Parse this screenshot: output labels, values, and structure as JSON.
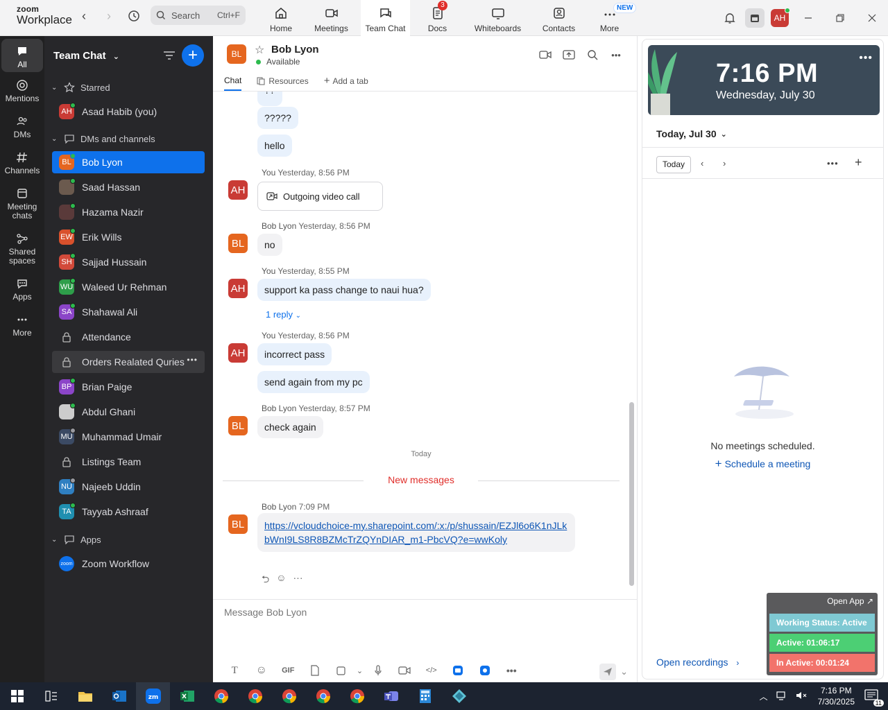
{
  "topbar": {
    "logo_top": "zoom",
    "logo_bottom": "Workplace",
    "search_placeholder": "Search",
    "search_shortcut": "Ctrl+F",
    "nav": [
      {
        "label": "Home",
        "icon": "home-icon"
      },
      {
        "label": "Meetings",
        "icon": "video-icon"
      },
      {
        "label": "Team Chat",
        "icon": "chat-icon",
        "active": true
      },
      {
        "label": "Docs",
        "icon": "docs-icon",
        "badge": "3"
      },
      {
        "label": "Whiteboards",
        "icon": "whiteboard-icon"
      },
      {
        "label": "Contacts",
        "icon": "contacts-icon"
      },
      {
        "label": "More",
        "icon": "more-icon",
        "badge_new": "NEW"
      }
    ],
    "user_initials": "AH"
  },
  "rail": [
    {
      "label": "All",
      "icon": "chat-bubble-icon",
      "active": true
    },
    {
      "label": "Mentions",
      "icon": "at-icon"
    },
    {
      "label": "DMs",
      "icon": "people-icon"
    },
    {
      "label": "Channels",
      "icon": "hash-icon"
    },
    {
      "label": "Meeting chats",
      "icon": "calendar-icon"
    },
    {
      "label": "Shared spaces",
      "icon": "share-icon"
    },
    {
      "label": "Apps",
      "icon": "apps-icon"
    },
    {
      "label": "More",
      "icon": "ellipsis-icon"
    }
  ],
  "sidebar": {
    "title": "Team Chat",
    "sections": {
      "starred": "Starred",
      "dms": "DMs and channels",
      "apps": "Apps"
    },
    "starred_items": [
      {
        "name": "Asad Habib (you)",
        "initials": "AH",
        "color": "#c93b35",
        "status": "online"
      }
    ],
    "items": [
      {
        "name": "Bob Lyon",
        "initials": "BL",
        "color": "#e5661f",
        "selected": true,
        "status": "online"
      },
      {
        "name": "Saad Hassan",
        "initials": "",
        "color": "#6b5a4e",
        "status": "online",
        "photo": true
      },
      {
        "name": "Hazama Nazir",
        "initials": "",
        "color": "#5a3a3a",
        "status": "online",
        "photo": true
      },
      {
        "name": "Erik Wills",
        "initials": "EW",
        "color": "#d9512c",
        "status": "online"
      },
      {
        "name": "Sajjad Hussain",
        "initials": "SH",
        "color": "#d24a3a",
        "status": "online"
      },
      {
        "name": "Waleed Ur Rehman",
        "initials": "WU",
        "color": "#2e9e4a",
        "status": "online"
      },
      {
        "name": "Shahawal Ali",
        "initials": "SA",
        "color": "#8b45c8",
        "status": "online"
      },
      {
        "name": "Attendance",
        "channel": true
      },
      {
        "name": "Orders Realated Quries",
        "channel": true,
        "hover": true
      },
      {
        "name": "Brian Paige",
        "initials": "BP",
        "color": "#8b45c8",
        "status": "online"
      },
      {
        "name": "Abdul Ghani",
        "initials": "",
        "color": "#cccccc",
        "status": "online",
        "photo": true
      },
      {
        "name": "Muhammad Umair",
        "initials": "MU",
        "color": "#3b4a64",
        "status": "away"
      },
      {
        "name": "Listings Team",
        "channel": true
      },
      {
        "name": "Najeeb Uddin",
        "initials": "NU",
        "color": "#2f7fc1",
        "status": "away"
      },
      {
        "name": "Tayyab Ashraaf",
        "initials": "TA",
        "color": "#1f8fb0",
        "status": "online"
      }
    ],
    "app_items": [
      {
        "name": "Zoom Workflow",
        "initials": "zoom",
        "color": "#0e71eb"
      }
    ]
  },
  "chat": {
    "contact_initials": "BL",
    "contact_name": "Bob Lyon",
    "contact_status": "Available",
    "tabs": [
      "Chat",
      "Resources",
      "Add a tab"
    ],
    "messages": [
      {
        "text_partial": "??"
      },
      {
        "text": "?????"
      },
      {
        "text": "hello"
      },
      {
        "sender": "You",
        "time": "Yesterday, 8:56 PM",
        "initials": "AH",
        "call": "Outgoing video call"
      },
      {
        "sender": "Bob Lyon",
        "time": "Yesterday, 8:56 PM",
        "initials": "BL",
        "text": "no"
      },
      {
        "sender": "You",
        "time": "Yesterday, 8:55 PM",
        "initials": "AH",
        "text": "support ka pass change to naui hua?",
        "reply": "1 reply"
      },
      {
        "sender": "You",
        "time": "Yesterday, 8:56 PM",
        "initials": "AH",
        "text": "incorrect pass",
        "text2": "send again from my pc"
      },
      {
        "sender": "Bob Lyon",
        "time": "Yesterday, 8:57 PM",
        "initials": "BL",
        "text": "check again"
      },
      {
        "sender": "Bob Lyon",
        "time": "7:09 PM",
        "initials": "BL",
        "link": "https://vcloudchoice-my.sharepoint.com/:x:/p/shussain/EZJl6o6K1nJLkbWnI9LS8R8BZMcTrZQYnDIAR_m1-PbcVQ?e=wwKoly"
      }
    ],
    "today_label": "Today",
    "new_messages_label": "New messages",
    "composer_placeholder": "Message Bob Lyon"
  },
  "right": {
    "time": "7:16 PM",
    "date": "Wednesday, July 30",
    "calendar_title": "Today, Jul 30",
    "today_button": "Today",
    "empty": "No meetings scheduled.",
    "schedule_link": "Schedule a meeting",
    "open_recordings": "Open recordings"
  },
  "widget": {
    "open_app": "Open App",
    "working_status": "Working Status: Active",
    "active": "Active: 01:06:17",
    "inactive": "In Active: 00:01:24",
    "colors": {
      "status": "#7fc9d3",
      "active": "#4ccf74",
      "inactive": "#f2736b"
    }
  },
  "taskbar": {
    "time": "7:16 PM",
    "date": "7/30/2025",
    "notifications": "11"
  },
  "colors": {
    "accent": "#0e71eb",
    "sidebar_bg": "#27272a",
    "rail_bg": "#202021",
    "danger": "#e02e2a"
  }
}
